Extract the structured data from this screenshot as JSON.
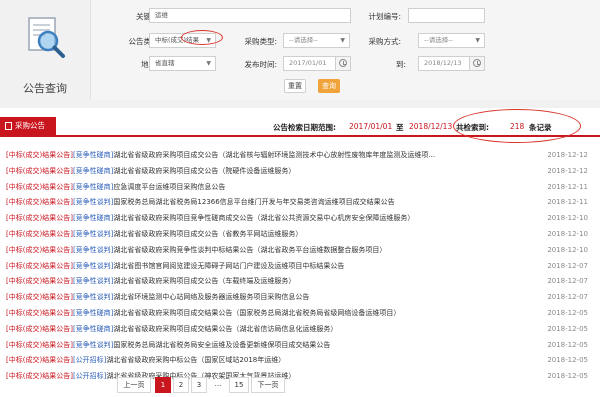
{
  "brand": {
    "title": "公告查询",
    "icon": "magnifier-document-icon"
  },
  "form": {
    "keyword": {
      "label": "关键字:",
      "value": "运维"
    },
    "plan_no": {
      "label": "计划编号:",
      "value": ""
    },
    "notice_type": {
      "label": "公告类型:",
      "value": "中标(成交)结果"
    },
    "purchase_type": {
      "label": "采购类型:",
      "value": "--请选择--"
    },
    "purchase_method": {
      "label": "采购方式:",
      "value": "--请选择--"
    },
    "region": {
      "label": "地 区:",
      "value": "省直辖"
    },
    "publish_time": {
      "label": "发布时间:",
      "value": "2017/01/01"
    },
    "to": {
      "label": "到:",
      "value": "2018/12/13"
    },
    "reset_label": "重置",
    "search_label": "查询"
  },
  "header": {
    "tab_label": "采购公告",
    "range_label": "公告检索日期范围:",
    "range_start": "2017/01/01",
    "range_sep": "至",
    "range_end": "2018/12/13",
    "count_label": "共检索到:",
    "count_value": "218",
    "count_unit": "条记录"
  },
  "rows": [
    {
      "tag1": "[中标(成交)结果公告]",
      "tag2": "[竞争性磋商]",
      "title": "湖北省省级政府采购项目成交公告（湖北省核与辐射环境监测技术中心放射性废物库年度监测及运维项...",
      "date": "2018-12-12"
    },
    {
      "tag1": "[中标(成交)结果公告]",
      "tag2": "[竞争性磋商]",
      "title": "湖北省省级政府采购项目成交公告（院硬件设备运维服务）",
      "date": "2018-12-12"
    },
    {
      "tag1": "[中标(成交)结果公告]",
      "tag2": "[竞争性磋商]",
      "title": "应急调度平台运维项目采购信息公告",
      "date": "2018-12-11"
    },
    {
      "tag1": "[中标(成交)结果公告]",
      "tag2": "[竞争性谈判]",
      "title": "国家税务总局湖北省税务局12366信息平台维门开发与年交易类咨询运维项目成交结果公告",
      "date": "2018-12-11"
    },
    {
      "tag1": "[中标(成交)结果公告]",
      "tag2": "[竞争性磋商]",
      "title": "湖北省省级政府采购项目竞争性磋商成交公告（湖北省公共资源交易中心机房安全保障运维服务）",
      "date": "2018-12-10"
    },
    {
      "tag1": "[中标(成交)结果公告]",
      "tag2": "[竞争性谈判]",
      "title": "湖北省省级政府采购项目成交公告（省教务平网站运维服务）",
      "date": "2018-12-10"
    },
    {
      "tag1": "[中标(成交)结果公告]",
      "tag2": "[竞争性谈判]",
      "title": "湖北省省级政府采购竞争性谈判中标结果公告（湖北省政务平台运维数据整合服务项目）",
      "date": "2018-12-10"
    },
    {
      "tag1": "[中标(成交)结果公告]",
      "tag2": "[竞争性谈判]",
      "title": "湖北省图书馆官网阅览建设无障碍子网站门户建设及运维项目中标结果公告",
      "date": "2018-12-07"
    },
    {
      "tag1": "[中标(成交)结果公告]",
      "tag2": "[竞争性谈判]",
      "title": "湖北省省级政府采购项目成交公告（车载终端及运维服务）",
      "date": "2018-12-07"
    },
    {
      "tag1": "[中标(成交)结果公告]",
      "tag2": "[竞争性谈判]",
      "title": "湖北省环境监测中心站网络及服务器运维服务项目采购信息公告",
      "date": "2018-12-07"
    },
    {
      "tag1": "[中标(成交)结果公告]",
      "tag2": "[竞争性磋商]",
      "title": "湖北省省级政府采购项目成交结果公告（国家税务总局湖北省税务局省级网络设备运维项目）",
      "date": "2018-12-05"
    },
    {
      "tag1": "[中标(成交)结果公告]",
      "tag2": "[竞争性磋商]",
      "title": "湖北省省级政府采购项目成交结果公告（湖北省信访局信息化运维服务）",
      "date": "2018-12-05"
    },
    {
      "tag1": "[中标(成交)结果公告]",
      "tag2": "[竞争性谈判]",
      "title": "国家税务总局湖北省税务局安全运维及设备更新维保项目成交结果公告",
      "date": "2018-12-05"
    },
    {
      "tag1": "[中标(成交)结果公告]",
      "tag2": "[公开招标]",
      "title": "湖北省省级政府采购中标公告（国家区域站2018年运维）",
      "date": "2018-12-05"
    },
    {
      "tag1": "[中标(成交)结果公告]",
      "tag2": "[公开招标]",
      "title": "湖北省省级政府采购中标公告（神农架国家大气背景站运维）",
      "date": "2018-12-05"
    }
  ],
  "pager": {
    "prev": "上一页",
    "pages": [
      "1",
      "2",
      "3"
    ],
    "dots": "...",
    "last": "15",
    "next": "下一页"
  }
}
